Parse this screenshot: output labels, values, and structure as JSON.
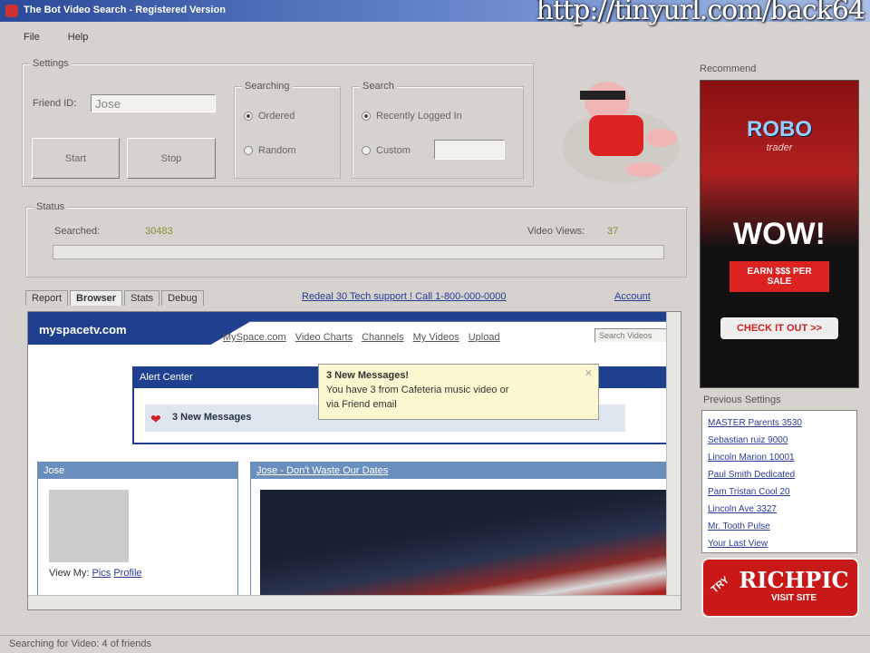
{
  "window": {
    "title": "The Bot Video Search - Registered Version",
    "watermark": "http://tinyurl.com/back64"
  },
  "menu": [
    "File",
    "Help"
  ],
  "settings": {
    "label": "Settings",
    "friend_id_label": "Friend ID:",
    "friend_id_value": "Jose",
    "start": "Start",
    "stop": "Stop",
    "searching": {
      "label": "Searching",
      "options": [
        "Ordered",
        "Random"
      ]
    },
    "search": {
      "label": "Search",
      "options": [
        "Recently Logged In",
        "Custom"
      ],
      "custom_value": ""
    }
  },
  "status": {
    "label": "Status",
    "searched_label": "Searched:",
    "searched_value": "30483",
    "views_label": "Video Views:",
    "views_value": "37",
    "progress": 0
  },
  "tabs": [
    "Report",
    "Browser",
    "Stats",
    "Debug"
  ],
  "center_link": "Redeal 30 Tech support ! Call 1-800-000-0000",
  "account_link": "Account",
  "browser": {
    "logo": "myspacetv.com",
    "nav": [
      "MySpace.com",
      "Video Charts",
      "Channels",
      "My Videos",
      "Upload"
    ],
    "search_placeholder": "Search Videos",
    "alert_title": "Alert Center",
    "messages": "3 New Messages",
    "tooltip_title": "3 New Messages!",
    "tooltip_line1": "You have 3 from Cafeteria music video or",
    "tooltip_line2": "via Friend email",
    "profile_title": "Jose",
    "view_my": "View My:",
    "pics": "Pics",
    "profile": "Profile",
    "video_title": "Jose - Don't Waste Our Dates"
  },
  "right": {
    "recommend": "Recommend",
    "ad_top": {
      "brand": "ROBO",
      "sub": "trader",
      "wow": "WOW!",
      "earn": "EARN $$$ PER SALE",
      "check": "CHECK IT OUT >>"
    },
    "previous_label": "Previous Settings",
    "previous": [
      "MASTER Parents 3530",
      "Sebastian ruiz 9000",
      "Lincoln Marion 10001",
      "Paul Smith Dedicated",
      "Pam Tristan Cool 20",
      "Lincoln Ave 3327",
      "Mr. Tooth Pulse",
      "Your Last View"
    ],
    "ad_bottom": {
      "brand": "RICHPIC",
      "sub": "VISIT SITE",
      "tag": "TRY"
    }
  },
  "statusbar": "Searching for Video: 4 of friends"
}
